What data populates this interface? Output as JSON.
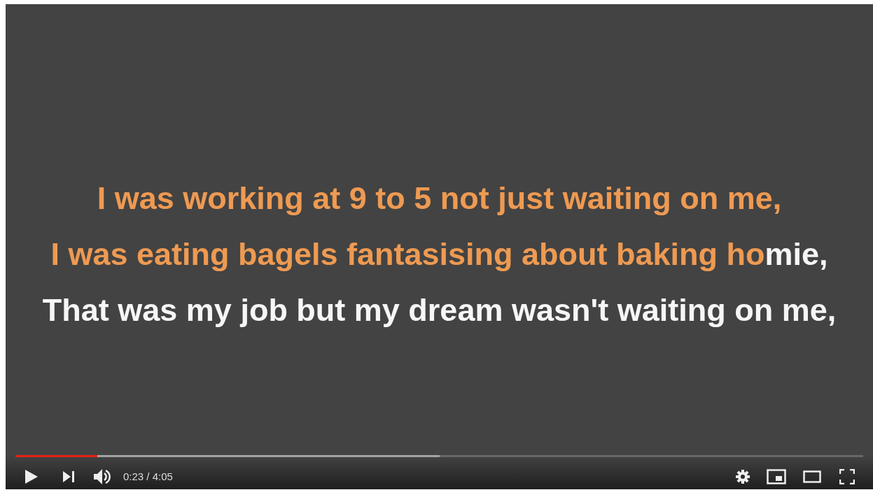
{
  "lyrics": [
    {
      "segments": [
        {
          "text": "I was working at 9 to 5 not just waiting on me,",
          "sung": true
        }
      ]
    },
    {
      "segments": [
        {
          "text": "I was eating bagels fantasising about baking ho",
          "sung": true
        },
        {
          "text": "mie,",
          "sung": false
        }
      ]
    },
    {
      "segments": [
        {
          "text": "That was my job but my dream wasn't waiting on me,",
          "sung": false
        }
      ]
    }
  ],
  "progress": {
    "level": 0.097
  },
  "buffer": {
    "level": 0.5
  },
  "controls": {
    "time": "0:23 / 4:05"
  }
}
